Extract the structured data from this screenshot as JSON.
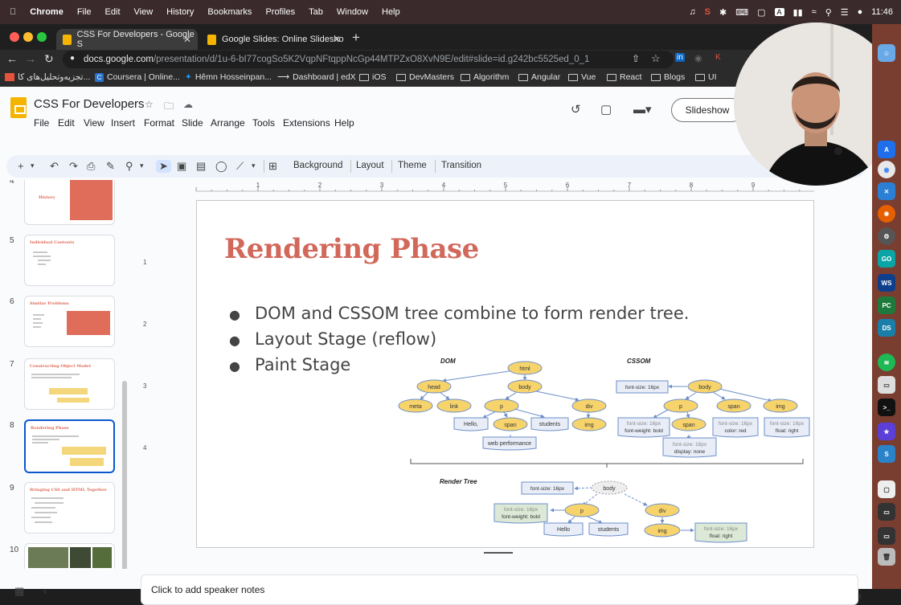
{
  "menubar": {
    "apple": "",
    "items": [
      "Chrome",
      "File",
      "Edit",
      "View",
      "History",
      "Bookmarks",
      "Profiles",
      "Tab",
      "Window",
      "Help"
    ],
    "time": "11:46"
  },
  "browser": {
    "tabs": [
      {
        "title": "CSS For Developers - Google S",
        "active": true
      },
      {
        "title": "Google Slides: Online Slidesho",
        "active": false
      }
    ],
    "url_host": "docs.google.com",
    "url_path": "/presentation/d/1u-6-bI77cogSo5K2VqpNFtqppNcGp44MTPZxO8XvN9E/edit#slide=id.g242bc5525ed_0_1",
    "bookmarks": [
      "تجزیه‌وتحلیل‌های کا...",
      "Coursera | Online...",
      "Hêmn Hosseinpan...",
      "Dashboard | edX",
      "iOS",
      "DevMasters",
      "Algorithm",
      "Angular",
      "Vue",
      "React",
      "Blogs",
      "UI"
    ]
  },
  "doc": {
    "title": "CSS For Developers",
    "menus": [
      "File",
      "Edit",
      "View",
      "Insert",
      "Format",
      "Slide",
      "Arrange",
      "Tools",
      "Extensions",
      "Help"
    ],
    "slideshow_label": "Slideshow",
    "toolbar_text": {
      "background": "Background",
      "layout": "Layout",
      "theme": "Theme",
      "transition": "Transition"
    }
  },
  "filmstrip": {
    "slides": [
      {
        "num": "4",
        "title": "History"
      },
      {
        "num": "5",
        "title": "Individual Contents"
      },
      {
        "num": "6",
        "title": "Similar Problems"
      },
      {
        "num": "7",
        "title": "Constructing Object Model"
      },
      {
        "num": "8",
        "title": "Rendering Phase",
        "selected": true
      },
      {
        "num": "9",
        "title": "Bringing CSS and HTML Together"
      },
      {
        "num": "10",
        "title": ""
      }
    ]
  },
  "ruler": {
    "h": [
      "1",
      "2",
      "3",
      "4",
      "5",
      "6",
      "7",
      "8",
      "9"
    ],
    "v": [
      "1",
      "2",
      "3",
      "4"
    ]
  },
  "slide": {
    "title": "Rendering Phase",
    "bullets": [
      "DOM and CSSOM tree combine to form render tree.",
      "Layout Stage (reflow)",
      "Paint Stage"
    ],
    "diagram": {
      "dom_label": "DOM",
      "cssom_label": "CSSOM",
      "render_label": "Render Tree",
      "dom": {
        "html": "html",
        "head": "head",
        "body": "body",
        "meta": "meta",
        "link": "link",
        "p": "p",
        "div": "div",
        "hello": "Hello,",
        "span": "span",
        "students": "students",
        "img": "img",
        "webperf": "web performance"
      },
      "cssom": {
        "body": "body",
        "fs": "font-size: 16px",
        "p": "p",
        "span": "span",
        "img": "img",
        "p_style1": "font-size: 16px",
        "p_style2": "font-weight: bold",
        "span_style1": "font-size: 16px",
        "span_style2": "color: red",
        "img_style1": "font-size: 16px",
        "img_style2": "float: right",
        "inner_span": "span",
        "inner1": "font-size: 16px",
        "inner2": "display: none"
      },
      "render": {
        "body": "body",
        "fs": "font-size: 16px",
        "p": "p",
        "div": "div",
        "p_style1": "font-size: 16px",
        "p_style2": "font-weight: bold",
        "hello": "Hello",
        "students": "students",
        "img": "img",
        "img_style1": "font-size: 16px",
        "img_style2": "float: right"
      }
    }
  },
  "notes_placeholder": "Click to add speaker notes",
  "colors": {
    "title": "#d2685a",
    "node_fill": "#f6d36b",
    "node_stroke": "#6d8fc9",
    "box_fill": "#e8edf7",
    "selected": "#0b57d0"
  }
}
